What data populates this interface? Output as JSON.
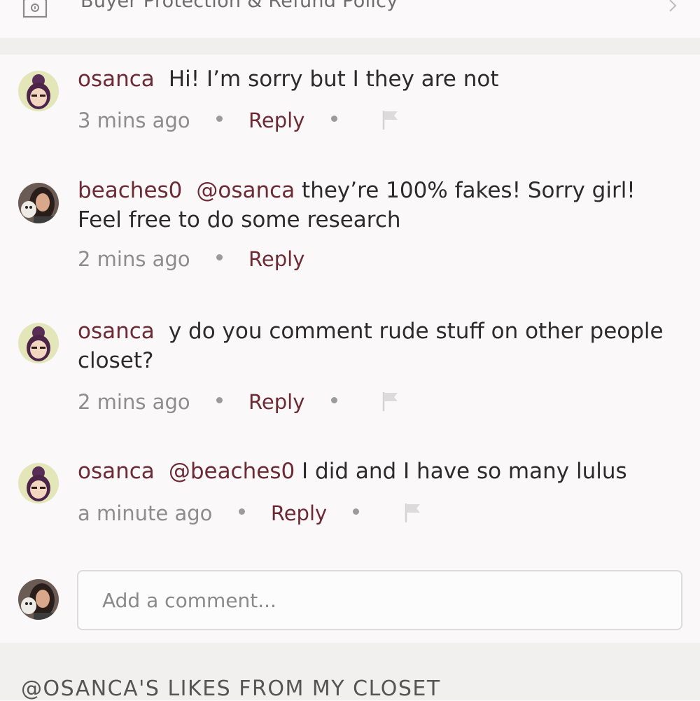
{
  "policy": {
    "label": "Buyer Protection & Refund Policy",
    "icon": "shield-badge-icon",
    "chevron": "chevron-right-icon"
  },
  "comments": [
    {
      "username": "osanca",
      "mention": "",
      "text": "Hi! I’m sorry but I they are not",
      "time": "3 mins ago",
      "reply_label": "Reply",
      "has_flag": true,
      "avatar": "osanca-avatar"
    },
    {
      "username": "beaches0",
      "mention": "@osanca",
      "text": " they’re 100% fakes! Sorry girl! Feel free to do some research",
      "time": "2 mins ago",
      "reply_label": "Reply",
      "has_flag": false,
      "avatar": "beaches0-avatar"
    },
    {
      "username": "osanca",
      "mention": "",
      "text": "y do you comment rude stuff on other people closet?",
      "time": "2 mins ago",
      "reply_label": "Reply",
      "has_flag": true,
      "avatar": "osanca-avatar"
    },
    {
      "username": "osanca",
      "mention": "@beaches0",
      "text": " I did and I have so many lulus",
      "time": "a minute ago",
      "reply_label": "Reply",
      "has_flag": true,
      "avatar": "osanca-avatar"
    }
  ],
  "add_comment": {
    "placeholder": "Add a comment..."
  },
  "likes_section": {
    "heading": "@OSANCA'S LIKES FROM MY CLOSET"
  },
  "colors": {
    "accent": "#6e2a34",
    "meta": "#8d8d8d",
    "background": "#faf8f8"
  }
}
